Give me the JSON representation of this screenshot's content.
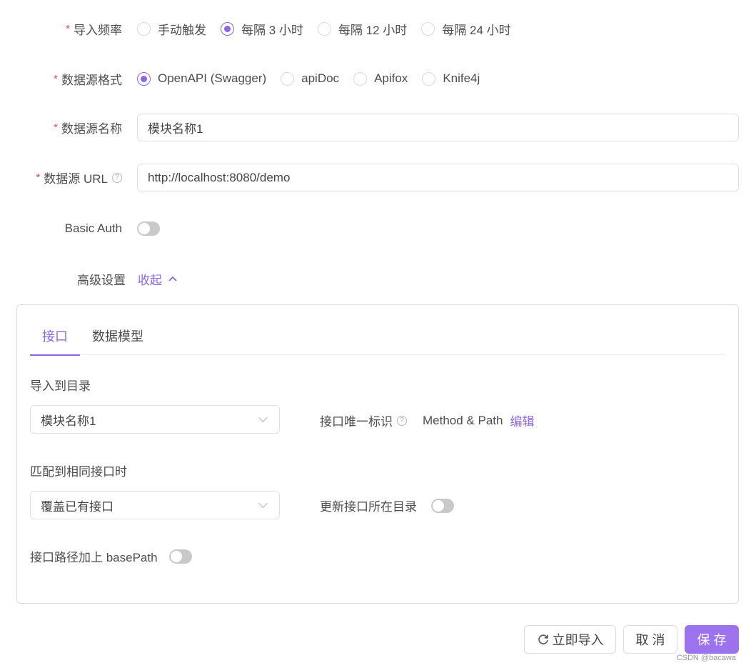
{
  "form": {
    "frequency": {
      "label": "导入频率",
      "required": "*",
      "options": [
        "手动触发",
        "每隔 3 小时",
        "每隔 12 小时",
        "每隔 24 小时"
      ],
      "selected": "每隔 3 小时"
    },
    "format": {
      "label": "数据源格式",
      "required": "*",
      "options": [
        "OpenAPI (Swagger)",
        "apiDoc",
        "Apifox",
        "Knife4j"
      ],
      "selected": "OpenAPI (Swagger)"
    },
    "name": {
      "label": "数据源名称",
      "required": "*",
      "value": "模块名称1"
    },
    "url": {
      "label": "数据源 URL",
      "required": "*",
      "help": "?",
      "value": "http://localhost:8080/demo"
    },
    "basic_auth": {
      "label": "Basic Auth",
      "enabled": false
    },
    "advanced": {
      "label": "高级设置",
      "toggle_text": "收起"
    }
  },
  "panel": {
    "tabs": [
      "接口",
      "数据模型"
    ],
    "active_tab": "接口",
    "import_dir": {
      "label": "导入到目录",
      "value": "模块名称1"
    },
    "unique_id": {
      "label": "接口唯一标识",
      "help": "?",
      "value": "Method & Path",
      "edit": "编辑"
    },
    "match": {
      "label": "匹配到相同接口时",
      "value": "覆盖已有接口"
    },
    "update_dir": {
      "label": "更新接口所在目录",
      "enabled": false
    },
    "base_path": {
      "label": "接口路径加上 basePath",
      "enabled": false
    }
  },
  "footer": {
    "import_now": "立即导入",
    "cancel": "取 消",
    "save": "保 存",
    "watermark": "CSDN @bacawa"
  },
  "colors": {
    "accent": "#8e65e6",
    "primary_button": "#9d72ef",
    "required": "#e5484d"
  }
}
